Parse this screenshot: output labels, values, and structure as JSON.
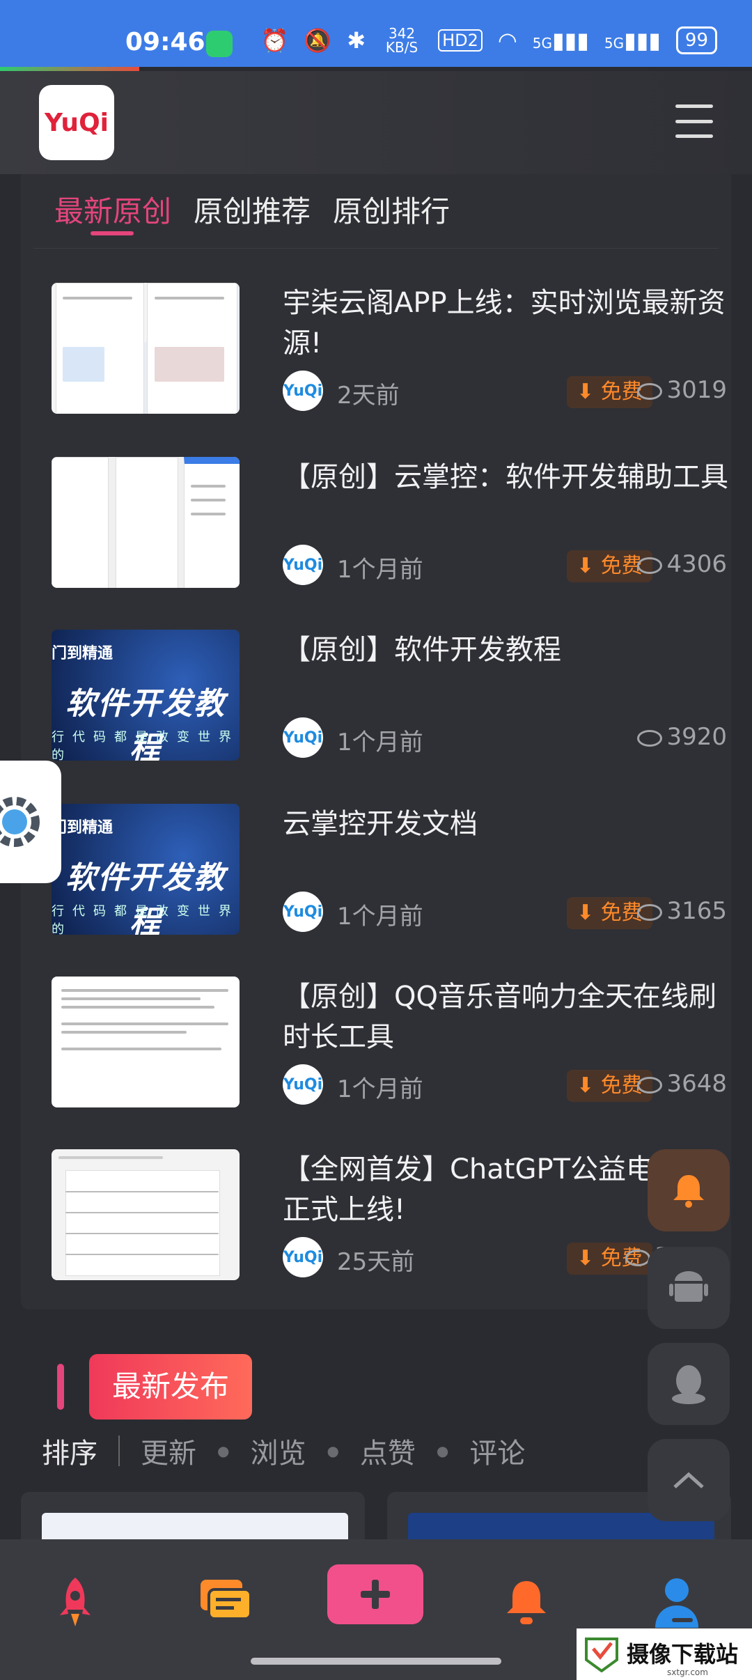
{
  "status_bar": {
    "time": "09:46",
    "speed": "342 KB/S",
    "hd": "HD2",
    "signal1": "5G",
    "signal2": "5G",
    "battery": "99"
  },
  "header": {
    "logo_text": "YuQi"
  },
  "tabs": [
    {
      "label": "最新原创",
      "active": true
    },
    {
      "label": "原创推荐",
      "active": false
    },
    {
      "label": "原创排行",
      "active": false
    }
  ],
  "items": [
    {
      "title": "宇柒云阁APP上线：实时浏览最新资源!",
      "time": "2天前",
      "free": "免费",
      "views": "3019",
      "thumb": "t1"
    },
    {
      "title": "【原创】云掌控：软件开发辅助工具",
      "time": "1个月前",
      "free": "免费",
      "views": "4306",
      "thumb": "t2"
    },
    {
      "title": "【原创】软件开发教程",
      "time": "1个月前",
      "free": "",
      "views": "3920",
      "thumb": "t3"
    },
    {
      "title": "云掌控开发文档",
      "time": "1个月前",
      "free": "免费",
      "views": "3165",
      "thumb": "t3"
    },
    {
      "title": "【原创】QQ音乐音响力全天在线刷时长工具",
      "time": "1个月前",
      "free": "免费",
      "views": "3648",
      "thumb": "t5"
    },
    {
      "title": "【全网首发】ChatGPT公益电脑版正式上线!",
      "time": "25天前",
      "free": "免费",
      "views": "3",
      "thumb": "t6"
    }
  ],
  "thumb_texts": {
    "tutorial_top": "门到精通",
    "tutorial_main": "软件开发教程",
    "tutorial_bottom": "行代码都是改变世界的"
  },
  "avatar_text": "YuQi",
  "section": {
    "title": "最新发布",
    "sort_label": "排序",
    "sort_options": [
      "更新",
      "浏览",
      "点赞",
      "评论"
    ]
  },
  "watermark": {
    "text": "摄像下载站",
    "sub": "sxtgr.com"
  },
  "colors": {
    "accent": "#e4457b",
    "free_text": "#ff8a2a",
    "status_bar": "#3d7ce6",
    "nav_plus": "#f2508b"
  },
  "icons": {
    "nav": [
      "rocket-icon",
      "chat-icon",
      "plus-icon",
      "bell-icon",
      "user-icon"
    ],
    "side": [
      "bell-icon",
      "android-icon",
      "qq-icon",
      "chevron-up-icon"
    ]
  }
}
